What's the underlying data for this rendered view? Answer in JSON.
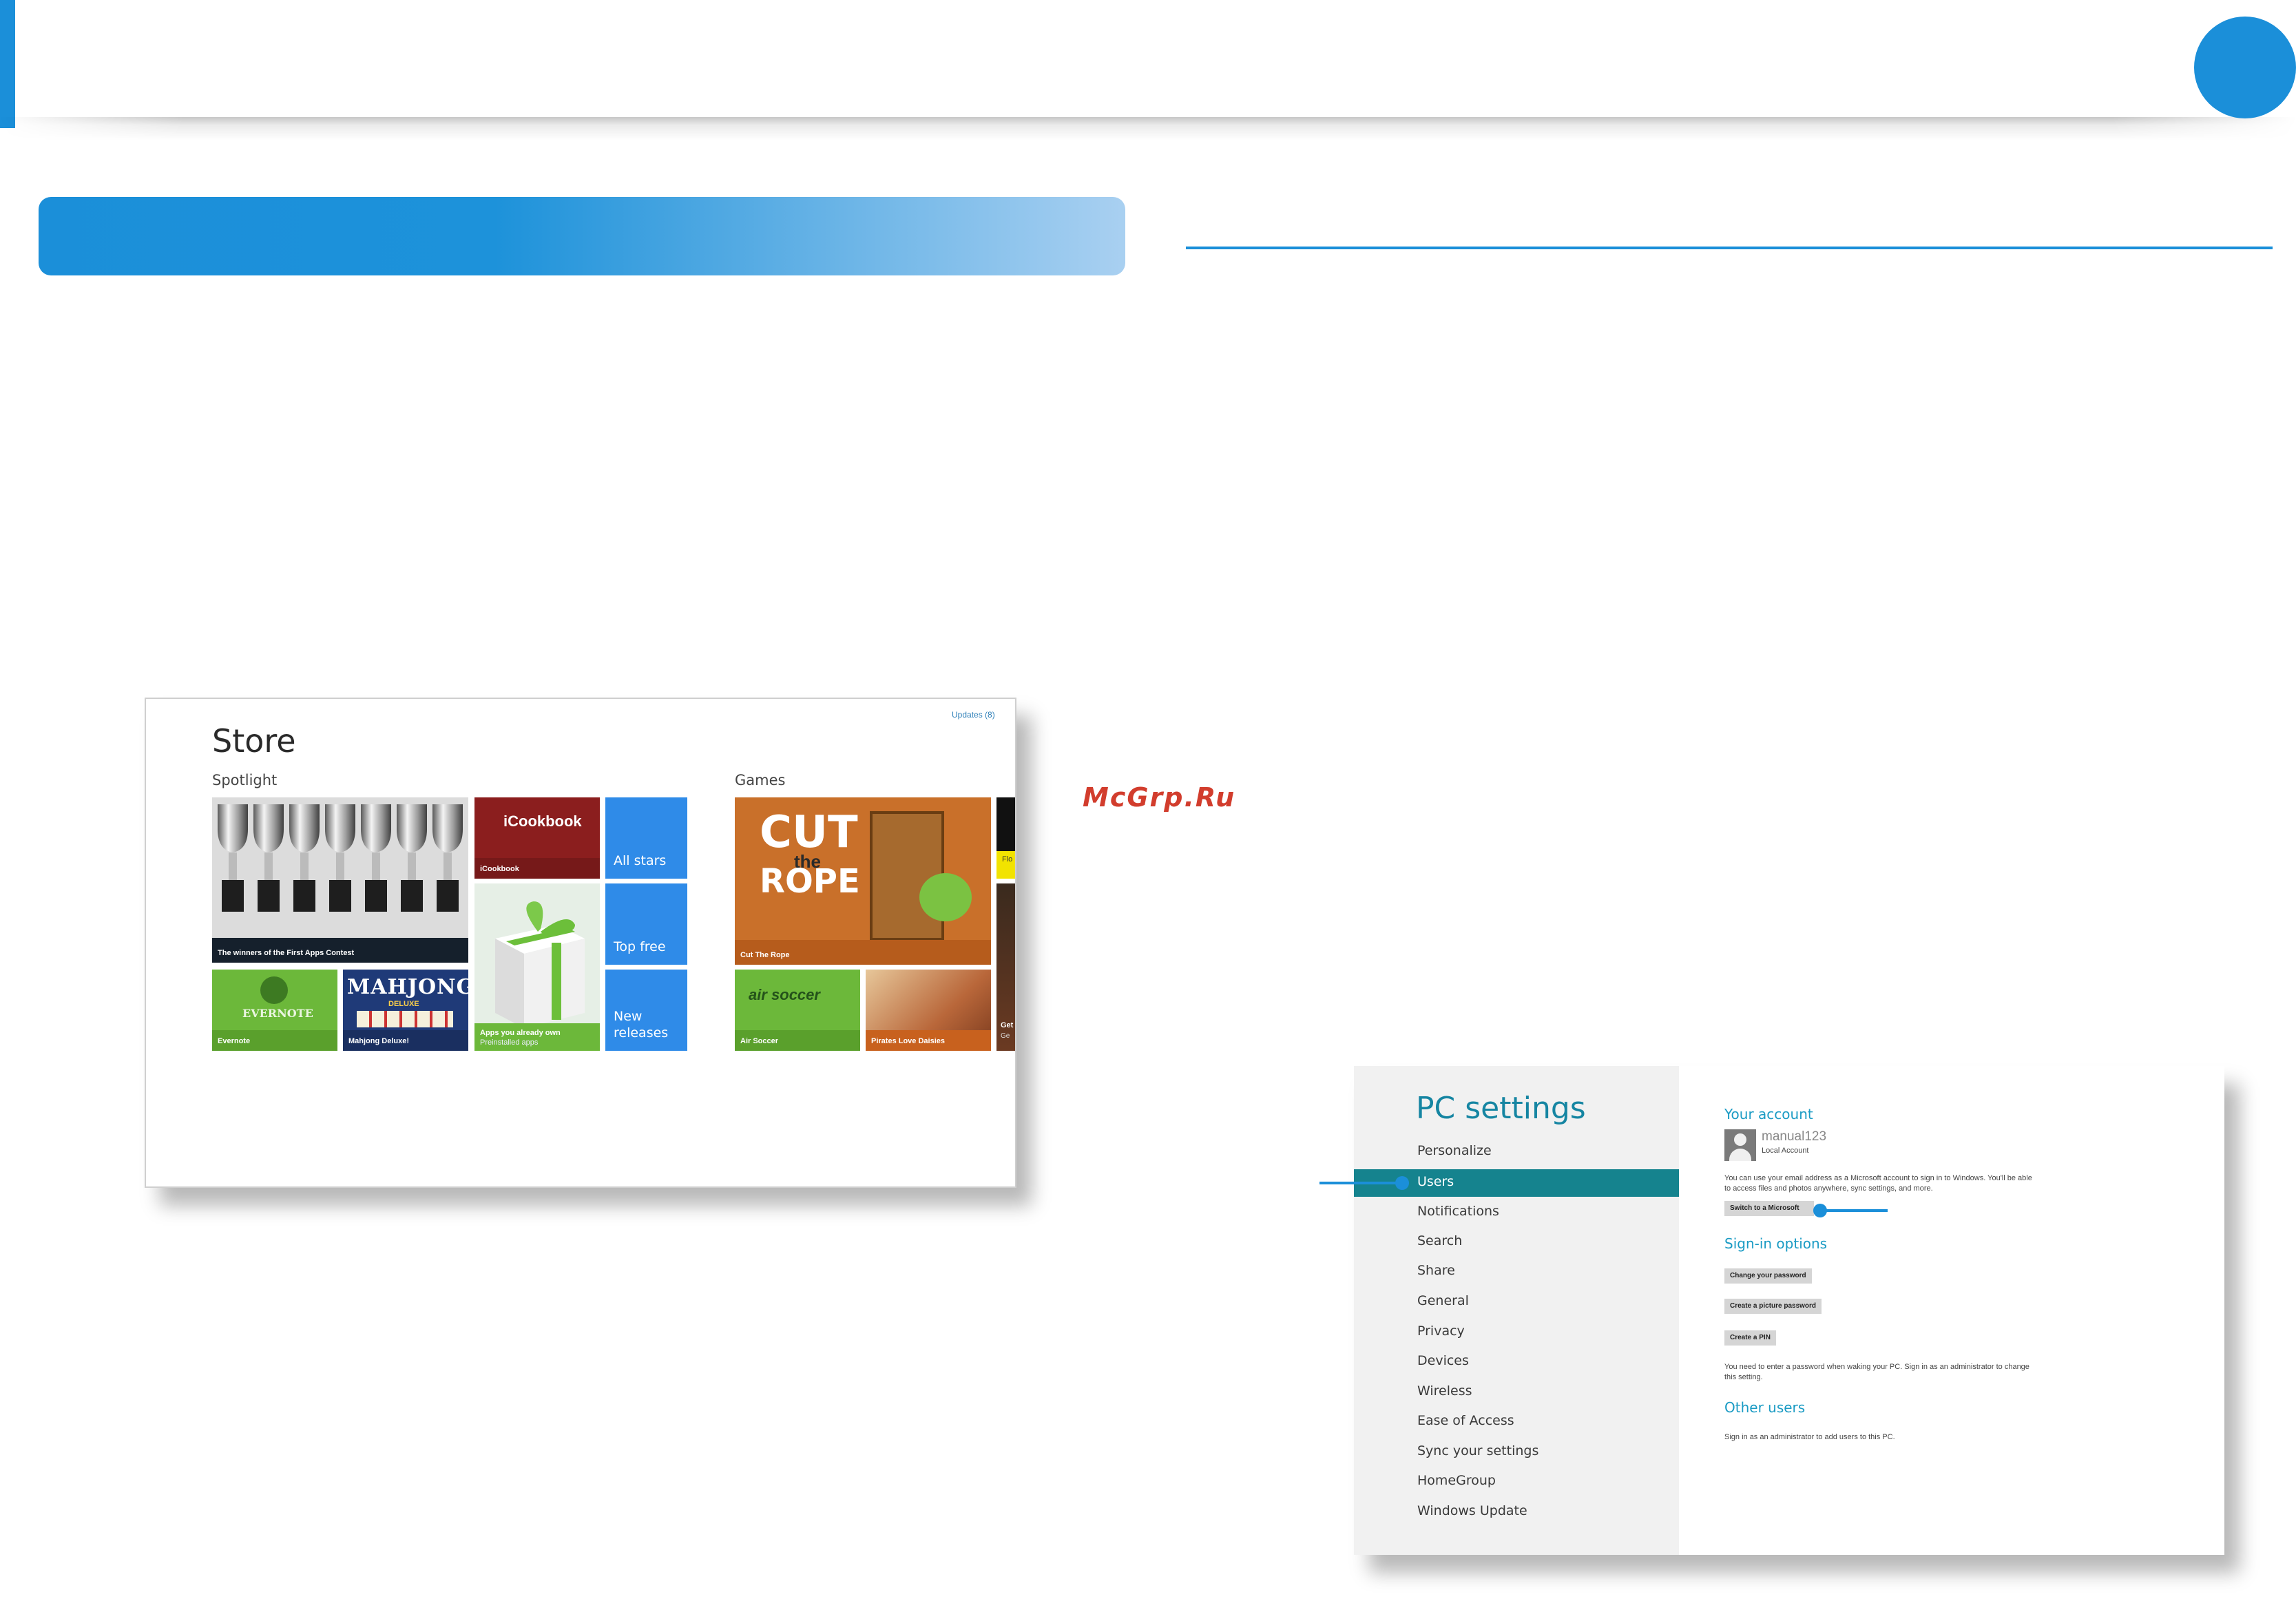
{
  "watermark": "McGrp.Ru",
  "store": {
    "title": "Store",
    "updates_link": "Updates (8)",
    "groups": {
      "spotlight": "Spotlight",
      "games": "Games"
    },
    "tiles": {
      "contest": "The winners of the First Apps Contest",
      "icookbook_logo": "iCookbook",
      "icookbook": "iCookbook",
      "all_stars": "All stars",
      "top_free": "Top free",
      "new_releases_line1": "New",
      "new_releases_line2": "releases",
      "evernote_logo": "EVERNOTE",
      "evernote": "Evernote",
      "mahjong_logo": "MAHJONG",
      "mahjong_sub": "DELUXE",
      "mahjong": "Mahjong Deluxe!",
      "apps_owned": "Apps you already own",
      "apps_owned_sub": "Preinstalled apps",
      "cut_the_rope_logo_1": "CUT",
      "cut_the_rope_logo_2": "the",
      "cut_the_rope_logo_3": "ROPE",
      "cut_the_rope": "Cut The Rope",
      "air_soccer_logo": "air soccer",
      "air_soccer": "Air Soccer",
      "pirates": "Pirates Love Daisies",
      "partial_1": "Flo",
      "partial_2": "Get",
      "partial_3": "Ge"
    },
    "colors": {
      "tile_blue": "#2f8be8",
      "ctr_bg": "#c9702a",
      "evernote_green": "#6cb83a",
      "cookbook_red": "#8b1e1e"
    }
  },
  "pc_settings": {
    "title": "PC settings",
    "nav": [
      "Personalize",
      "Users",
      "Notifications",
      "Search",
      "Share",
      "General",
      "Privacy",
      "Devices",
      "Wireless",
      "Ease of Access",
      "Sync your settings",
      "HomeGroup",
      "Windows Update"
    ],
    "selected_nav": "Users",
    "your_account": {
      "heading": "Your account",
      "username": "manual123",
      "account_type": "Local Account",
      "description_1": "You can use your email address as a Microsoft account to sign in to Windows. You'll be able",
      "description_2": "to access files and photos anywhere, sync settings, and more.",
      "switch_button": "Switch to a Microsoft"
    },
    "sign_in": {
      "heading": "Sign-in options",
      "change_password": "Change your password",
      "picture_password": "Create a picture password",
      "create_pin": "Create a PIN",
      "note_1": "You need to enter a password when waking your PC. Sign in as an administrator to change",
      "note_2": "this setting."
    },
    "other_users": {
      "heading": "Other users",
      "note": "Sign in as an administrator to add users to this PC."
    },
    "colors": {
      "accent": "#1a9bc4",
      "selected_bg": "#15838e"
    }
  },
  "theme": {
    "brand_blue": "#1b8fd9"
  }
}
